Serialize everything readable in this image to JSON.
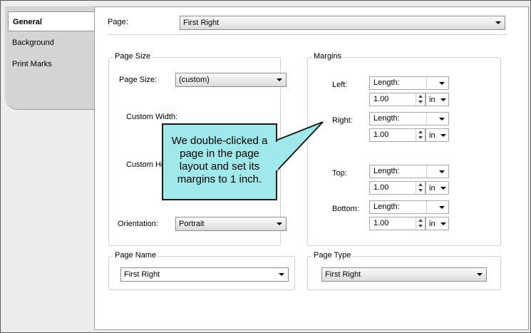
{
  "tabs": [
    {
      "label": "General",
      "active": true
    },
    {
      "label": "Background",
      "active": false
    },
    {
      "label": "Print Marks",
      "active": false
    }
  ],
  "page": {
    "label": "Page:",
    "value": "First Right"
  },
  "page_size": {
    "group_title": "Page Size",
    "size_label": "Page Size:",
    "size_value": "(custom)",
    "custom_width_label": "Custom Width:",
    "custom_height_label": "Custom He",
    "orientation_label": "Orientation:",
    "orientation_value": "Portrait"
  },
  "margins": {
    "group_title": "Margins",
    "rows": [
      {
        "label": "Left:",
        "type": "Length:",
        "value": "1.00",
        "unit": "in"
      },
      {
        "label": "Right:",
        "type": "Length:",
        "value": "1.00",
        "unit": "in"
      },
      {
        "label": "Top:",
        "type": "Length:",
        "value": "1.00",
        "unit": "in"
      },
      {
        "label": "Bottom:",
        "type": "Length:",
        "value": "1.00",
        "unit": "in"
      }
    ]
  },
  "page_name": {
    "group_title": "Page Name",
    "value": "First Right"
  },
  "page_type": {
    "group_title": "Page Type",
    "value": "First Right"
  },
  "callout": {
    "text": "We double-clicked a page in the page layout and set its margins to 1 inch.",
    "color": "#9fe9ea"
  }
}
